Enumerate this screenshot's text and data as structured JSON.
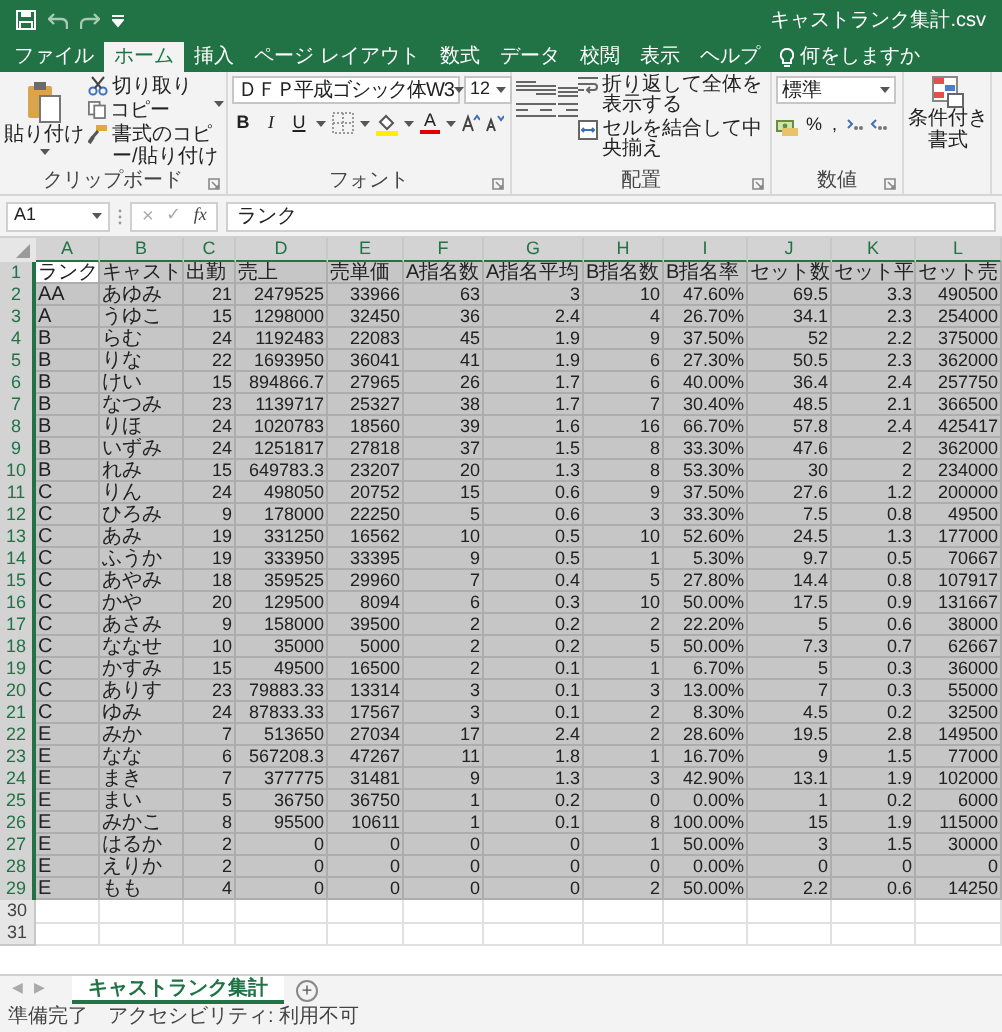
{
  "window": {
    "title": "キャストランク集計.csv"
  },
  "tabs": [
    {
      "label": "ファイル",
      "selected": false
    },
    {
      "label": "ホーム",
      "selected": true
    },
    {
      "label": "挿入",
      "selected": false
    },
    {
      "label": "ページ レイアウト",
      "selected": false
    },
    {
      "label": "数式",
      "selected": false
    },
    {
      "label": "データ",
      "selected": false
    },
    {
      "label": "校閲",
      "selected": false
    },
    {
      "label": "表示",
      "selected": false
    },
    {
      "label": "ヘルプ",
      "selected": false
    }
  ],
  "tell_me": {
    "placeholder": "何をしますか"
  },
  "ribbon": {
    "groups": [
      {
        "kind": "clipboard",
        "label": "クリップボード",
        "paste": "貼り付け",
        "items": [
          "切り取り",
          "コピー",
          "書式のコピー/貼り付け"
        ]
      },
      {
        "kind": "font",
        "label": "フォント",
        "font_name": "ＤＦＰ平成ゴシック体W3",
        "font_size": "12",
        "styles": [
          "B",
          "I",
          "U"
        ],
        "font_color_letter": "A"
      },
      {
        "kind": "alignment",
        "label": "配置",
        "commands": [
          "折り返して全体を表示する",
          "セルを結合して中央揃え"
        ]
      },
      {
        "kind": "number",
        "label": "数値",
        "format": "標準",
        "symbols": [
          "%",
          ","
        ]
      },
      {
        "kind": "conditional",
        "lines": [
          "条件付き",
          "書式"
        ]
      }
    ]
  },
  "formula_bar": {
    "name_box": "A1",
    "cancel": "×",
    "enter": "✓",
    "fx": "fx",
    "value": "ランク"
  },
  "sheet": {
    "selected": true,
    "columns": [
      {
        "letter": "A",
        "kind": "text"
      },
      {
        "letter": "B",
        "kind": "text"
      },
      {
        "letter": "C",
        "kind": "number"
      },
      {
        "letter": "D",
        "kind": "number"
      },
      {
        "letter": "E",
        "kind": "number"
      },
      {
        "letter": "F",
        "kind": "number"
      },
      {
        "letter": "G",
        "kind": "number"
      },
      {
        "letter": "H",
        "kind": "number"
      },
      {
        "letter": "I",
        "kind": "number"
      },
      {
        "letter": "J",
        "kind": "number"
      },
      {
        "letter": "K",
        "kind": "number"
      },
      {
        "letter": "L",
        "kind": "number"
      }
    ],
    "rows": [
      {
        "number": "1",
        "kind": "header",
        "cells": [
          "ランク",
          "キャスト",
          "出勤",
          "売上",
          "売単価",
          "A指名数",
          "A指名平均",
          "B指名数",
          "B指名率",
          "セット数",
          "セット平",
          "セット売"
        ]
      },
      {
        "number": "2",
        "kind": "data",
        "cells": [
          "AA",
          "あゆみ",
          "21",
          "2479525",
          "33966",
          "63",
          "3",
          "10",
          "47.60%",
          "69.5",
          "3.3",
          "490500"
        ]
      },
      {
        "number": "3",
        "kind": "data",
        "cells": [
          "A",
          "うゆこ",
          "15",
          "1298000",
          "32450",
          "36",
          "2.4",
          "4",
          "26.70%",
          "34.1",
          "2.3",
          "254000"
        ]
      },
      {
        "number": "4",
        "kind": "data",
        "cells": [
          "B",
          "らむ",
          "24",
          "1192483",
          "22083",
          "45",
          "1.9",
          "9",
          "37.50%",
          "52",
          "2.2",
          "375000"
        ]
      },
      {
        "number": "5",
        "kind": "data",
        "cells": [
          "B",
          "りな",
          "22",
          "1693950",
          "36041",
          "41",
          "1.9",
          "6",
          "27.30%",
          "50.5",
          "2.3",
          "362000"
        ]
      },
      {
        "number": "6",
        "kind": "data",
        "cells": [
          "B",
          "けい",
          "15",
          "894866.7",
          "27965",
          "26",
          "1.7",
          "6",
          "40.00%",
          "36.4",
          "2.4",
          "257750"
        ]
      },
      {
        "number": "7",
        "kind": "data",
        "cells": [
          "B",
          "なつみ",
          "23",
          "1139717",
          "25327",
          "38",
          "1.7",
          "7",
          "30.40%",
          "48.5",
          "2.1",
          "366500"
        ]
      },
      {
        "number": "8",
        "kind": "data",
        "cells": [
          "B",
          "りほ",
          "24",
          "1020783",
          "18560",
          "39",
          "1.6",
          "16",
          "66.70%",
          "57.8",
          "2.4",
          "425417"
        ]
      },
      {
        "number": "9",
        "kind": "data",
        "cells": [
          "B",
          "いずみ",
          "24",
          "1251817",
          "27818",
          "37",
          "1.5",
          "8",
          "33.30%",
          "47.6",
          "2",
          "362000"
        ]
      },
      {
        "number": "10",
        "kind": "data",
        "cells": [
          "B",
          "れみ",
          "15",
          "649783.3",
          "23207",
          "20",
          "1.3",
          "8",
          "53.30%",
          "30",
          "2",
          "234000"
        ]
      },
      {
        "number": "11",
        "kind": "data",
        "cells": [
          "C",
          "りん",
          "24",
          "498050",
          "20752",
          "15",
          "0.6",
          "9",
          "37.50%",
          "27.6",
          "1.2",
          "200000"
        ]
      },
      {
        "number": "12",
        "kind": "data",
        "cells": [
          "C",
          "ひろみ",
          "9",
          "178000",
          "22250",
          "5",
          "0.6",
          "3",
          "33.30%",
          "7.5",
          "0.8",
          "49500"
        ]
      },
      {
        "number": "13",
        "kind": "data",
        "cells": [
          "C",
          "あみ",
          "19",
          "331250",
          "16562",
          "10",
          "0.5",
          "10",
          "52.60%",
          "24.5",
          "1.3",
          "177000"
        ]
      },
      {
        "number": "14",
        "kind": "data",
        "cells": [
          "C",
          "ふうか",
          "19",
          "333950",
          "33395",
          "9",
          "0.5",
          "1",
          "5.30%",
          "9.7",
          "0.5",
          "70667"
        ]
      },
      {
        "number": "15",
        "kind": "data",
        "cells": [
          "C",
          "あやみ",
          "18",
          "359525",
          "29960",
          "7",
          "0.4",
          "5",
          "27.80%",
          "14.4",
          "0.8",
          "107917"
        ]
      },
      {
        "number": "16",
        "kind": "data",
        "cells": [
          "C",
          "かや",
          "20",
          "129500",
          "8094",
          "6",
          "0.3",
          "10",
          "50.00%",
          "17.5",
          "0.9",
          "131667"
        ]
      },
      {
        "number": "17",
        "kind": "data",
        "cells": [
          "C",
          "あさみ",
          "9",
          "158000",
          "39500",
          "2",
          "0.2",
          "2",
          "22.20%",
          "5",
          "0.6",
          "38000"
        ]
      },
      {
        "number": "18",
        "kind": "data",
        "cells": [
          "C",
          "ななせ",
          "10",
          "35000",
          "5000",
          "2",
          "0.2",
          "5",
          "50.00%",
          "7.3",
          "0.7",
          "62667"
        ]
      },
      {
        "number": "19",
        "kind": "data",
        "cells": [
          "C",
          "かすみ",
          "15",
          "49500",
          "16500",
          "2",
          "0.1",
          "1",
          "6.70%",
          "5",
          "0.3",
          "36000"
        ]
      },
      {
        "number": "20",
        "kind": "data",
        "cells": [
          "C",
          "ありす",
          "23",
          "79883.33",
          "13314",
          "3",
          "0.1",
          "3",
          "13.00%",
          "7",
          "0.3",
          "55000"
        ]
      },
      {
        "number": "21",
        "kind": "data",
        "cells": [
          "C",
          "ゆみ",
          "24",
          "87833.33",
          "17567",
          "3",
          "0.1",
          "2",
          "8.30%",
          "4.5",
          "0.2",
          "32500"
        ]
      },
      {
        "number": "22",
        "kind": "data",
        "cells": [
          "E",
          "みか",
          "7",
          "513650",
          "27034",
          "17",
          "2.4",
          "2",
          "28.60%",
          "19.5",
          "2.8",
          "149500"
        ]
      },
      {
        "number": "23",
        "kind": "data",
        "cells": [
          "E",
          "なな",
          "6",
          "567208.3",
          "47267",
          "11",
          "1.8",
          "1",
          "16.70%",
          "9",
          "1.5",
          "77000"
        ]
      },
      {
        "number": "24",
        "kind": "data",
        "cells": [
          "E",
          "まき",
          "7",
          "377775",
          "31481",
          "9",
          "1.3",
          "3",
          "42.90%",
          "13.1",
          "1.9",
          "102000"
        ]
      },
      {
        "number": "25",
        "kind": "data",
        "cells": [
          "E",
          "まい",
          "5",
          "36750",
          "36750",
          "1",
          "0.2",
          "0",
          "0.00%",
          "1",
          "0.2",
          "6000"
        ]
      },
      {
        "number": "26",
        "kind": "data",
        "cells": [
          "E",
          "みかこ",
          "8",
          "95500",
          "10611",
          "1",
          "0.1",
          "8",
          "100.00%",
          "15",
          "1.9",
          "115000"
        ]
      },
      {
        "number": "27",
        "kind": "data",
        "cells": [
          "E",
          "はるか",
          "2",
          "0",
          "0",
          "0",
          "0",
          "1",
          "50.00%",
          "3",
          "1.5",
          "30000"
        ]
      },
      {
        "number": "28",
        "kind": "data",
        "cells": [
          "E",
          "えりか",
          "2",
          "0",
          "0",
          "0",
          "0",
          "0",
          "0.00%",
          "0",
          "0",
          "0"
        ]
      },
      {
        "number": "29",
        "kind": "data",
        "cells": [
          "E",
          "もも",
          "4",
          "0",
          "0",
          "0",
          "0",
          "2",
          "50.00%",
          "2.2",
          "0.6",
          "14250"
        ]
      }
    ],
    "empty_rows": [
      "30",
      "31"
    ]
  },
  "sheet_tabs": {
    "scroll_left": "◀",
    "scroll_right": "▶",
    "tabs": [
      {
        "label": "キャストランク集計",
        "selected": true
      }
    ],
    "add": "+"
  },
  "status_bar": {
    "ready": "準備完了",
    "accessibility": "アクセシビリティ: 利用不可"
  }
}
